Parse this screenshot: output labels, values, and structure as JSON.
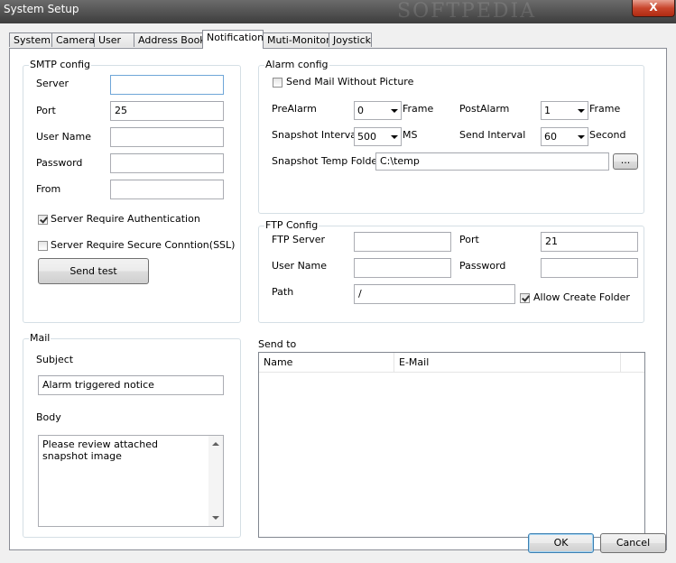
{
  "window": {
    "title": "System Setup",
    "close_glyph": "X",
    "watermark": "SOFTPEDIA"
  },
  "tabs": [
    {
      "label": "System"
    },
    {
      "label": "Camera"
    },
    {
      "label": "User"
    },
    {
      "label": "Address Book"
    },
    {
      "label": "Notification",
      "active": true
    },
    {
      "label": "Muti-Monitor"
    },
    {
      "label": "Joystick"
    }
  ],
  "smtp": {
    "title": "SMTP config",
    "server_label": "Server",
    "server_value": "",
    "port_label": "Port",
    "port_value": "25",
    "username_label": "User Name",
    "username_value": "",
    "password_label": "Password",
    "password_value": "",
    "from_label": "From",
    "from_value": "",
    "auth_label": "Server Require Authentication",
    "auth_checked": true,
    "ssl_label": "Server Require Secure Conntion(SSL)",
    "ssl_checked": false,
    "send_test_label": "Send test"
  },
  "alarm": {
    "title": "Alarm config",
    "no_picture_label": "Send Mail Without Picture",
    "no_picture_checked": false,
    "prealarm_label": "PreAlarm",
    "prealarm_value": "0",
    "prealarm_unit": "Frame",
    "postalarm_label": "PostAlarm",
    "postalarm_value": "1",
    "postalarm_unit": "Frame",
    "snapshot_interval_label": "Snapshot Interval",
    "snapshot_interval_value": "500",
    "snapshot_interval_unit": "MS",
    "send_interval_label": "Send Interval",
    "send_interval_value": "60",
    "send_interval_unit": "Second",
    "temp_folder_label": "Snapshot Temp Folder",
    "temp_folder_value": "C:\\temp",
    "browse_label": "..."
  },
  "ftp": {
    "title": "FTP Config",
    "server_label": "FTP Server",
    "server_value": "",
    "port_label": "Port",
    "port_value": "21",
    "username_label": "User Name",
    "username_value": "",
    "password_label": "Password",
    "password_value": "",
    "path_label": "Path",
    "path_value": "/",
    "allow_create_label": "Allow Create Folder",
    "allow_create_checked": true
  },
  "mail": {
    "title": "Mail",
    "subject_label": "Subject",
    "subject_value": "Alarm triggered notice",
    "body_label": "Body",
    "body_value": "Please review attached snapshot image"
  },
  "send_to": {
    "title": "Send to",
    "columns": [
      "Name",
      "E-Mail"
    ],
    "rows": []
  },
  "footer": {
    "ok_label": "OK",
    "cancel_label": "Cancel"
  }
}
